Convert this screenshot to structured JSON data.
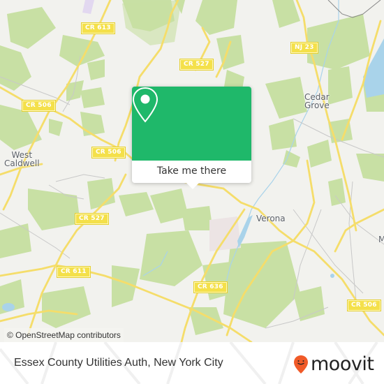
{
  "map": {
    "attribution": "© OpenStreetMap contributors",
    "road_labels": [
      {
        "id": "cr613",
        "text": "CR 613"
      },
      {
        "id": "cr506-west",
        "text": "CR 506"
      },
      {
        "id": "cr506-center",
        "text": "CR 506"
      },
      {
        "id": "cr527-north",
        "text": "CR 527"
      },
      {
        "id": "nj23",
        "text": "NJ 23"
      },
      {
        "id": "cr527-south",
        "text": "CR 527"
      },
      {
        "id": "cr611",
        "text": "CR 611"
      },
      {
        "id": "cr636",
        "text": "CR 636"
      },
      {
        "id": "cr506-east",
        "text": "CR 506"
      }
    ],
    "place_labels": [
      {
        "id": "west-caldwell",
        "text": "West\nCaldwell"
      },
      {
        "id": "cedar-grove",
        "text": "Cedar\nGrove"
      },
      {
        "id": "verona",
        "text": "Verona"
      },
      {
        "id": "montclair-partial",
        "text": "M"
      }
    ],
    "colors": {
      "background": "#f2f2ee",
      "park": "#c8e0a4",
      "road": "#f5dd6a",
      "water": "#a9d3ea",
      "commercial": "#ece4e4"
    }
  },
  "popup": {
    "button_label": "Take me there",
    "icon": "location-pin-icon",
    "color": "#1fb86a"
  },
  "footer": {
    "title": "Essex County Utilities Auth, New York City",
    "brand": "moovit",
    "brand_color": "#f05a28"
  }
}
